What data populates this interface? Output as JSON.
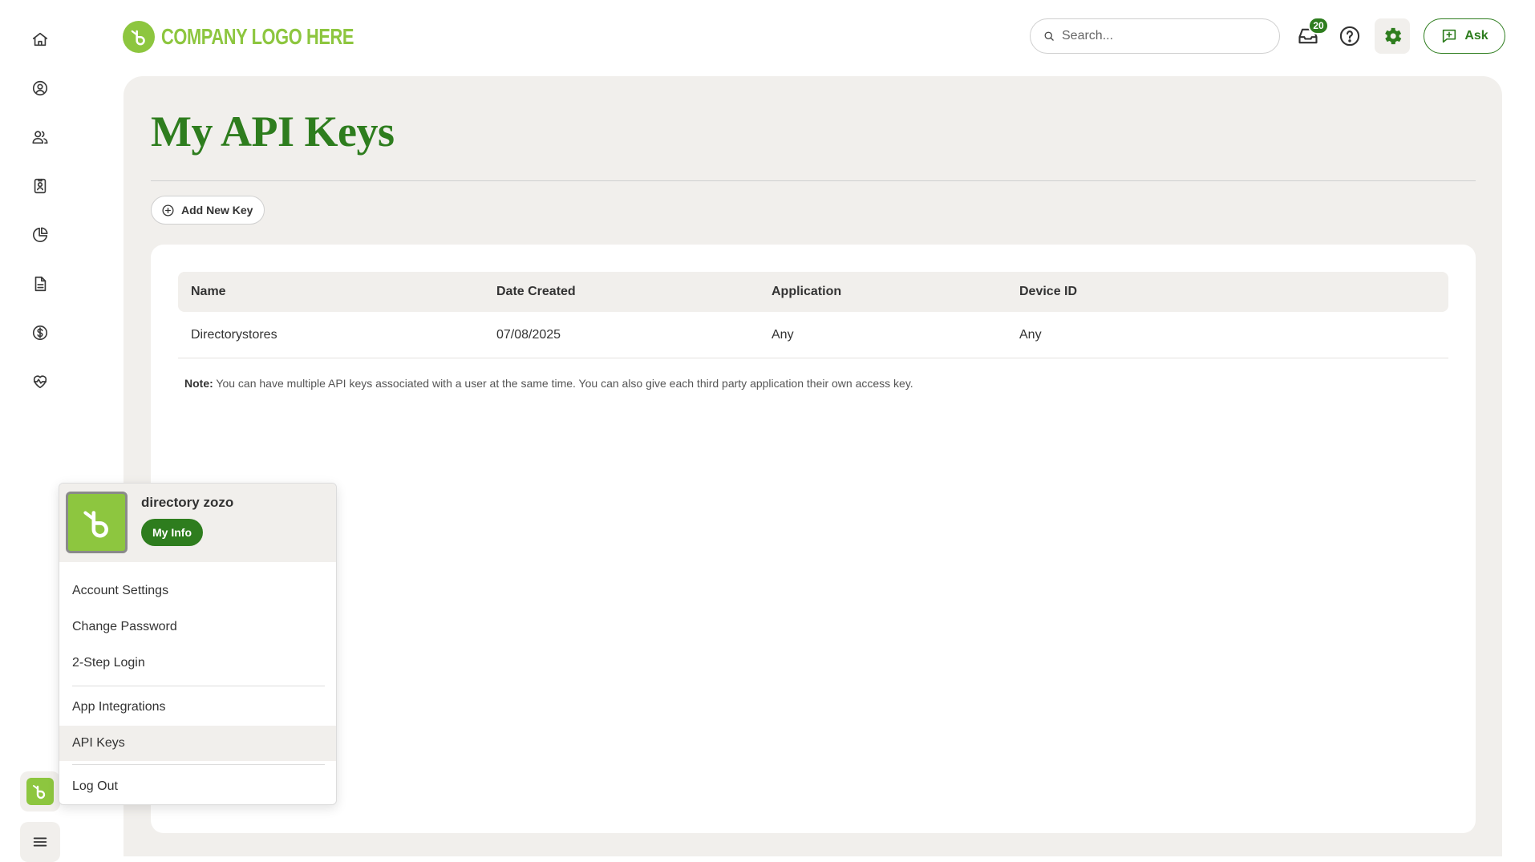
{
  "header": {
    "logo_text": "COMPANY LOGO HERE",
    "search_placeholder": "Search...",
    "notification_count": "20",
    "ask_label": "Ask"
  },
  "sidebar": {
    "icons": [
      "home-icon",
      "user-circle-icon",
      "people-icon",
      "id-badge-icon",
      "pie-chart-icon",
      "document-icon",
      "dollar-icon",
      "heart-pulse-icon"
    ]
  },
  "page": {
    "title": "My API Keys",
    "add_key_label": "Add New Key"
  },
  "table": {
    "columns": [
      "Name",
      "Date Created",
      "Application",
      "Device ID"
    ],
    "rows": [
      [
        "Directorystores",
        "07/08/2025",
        "Any",
        "Any"
      ]
    ]
  },
  "note": {
    "label": "Note:",
    "text": "You can have multiple API keys associated with a user at the same time. You can also give each third party application their own access key."
  },
  "user_menu": {
    "name": "directory zozo",
    "my_info_label": "My Info",
    "items": [
      "Account Settings",
      "Change Password",
      "2-Step Login",
      "App Integrations",
      "API Keys",
      "Log Out"
    ],
    "active_item": "API Keys"
  },
  "colors": {
    "brand_green": "#2e7d1e",
    "logo_green": "#8dc63f",
    "panel_bg": "#f1efec"
  }
}
